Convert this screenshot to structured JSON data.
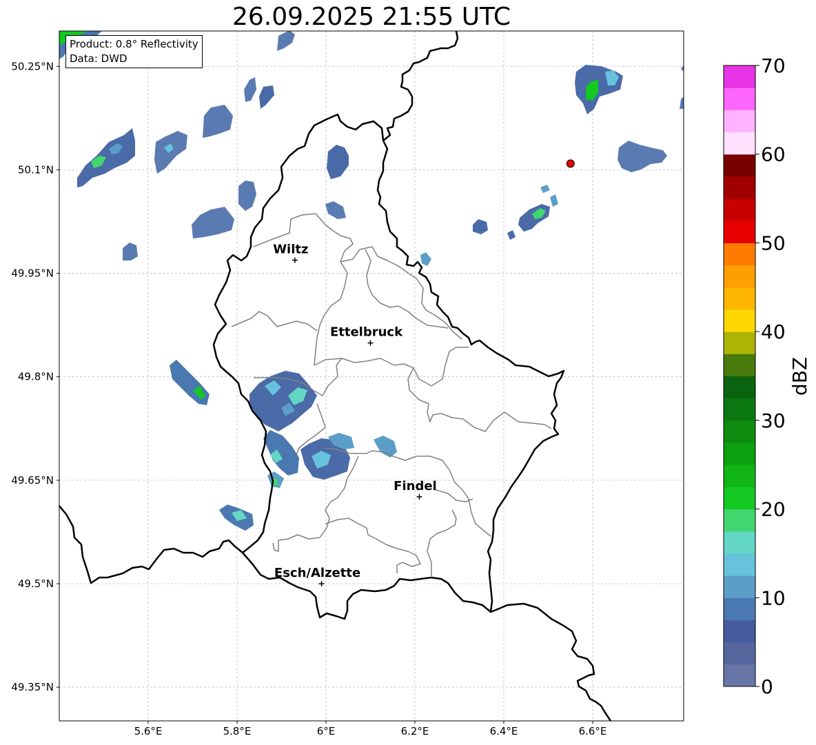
{
  "title": "26.09.2025 21:55 UTC",
  "info": {
    "product": "Product: 0.8° Reflectivity",
    "data": "Data: DWD"
  },
  "map": {
    "lat_ticks": [
      {
        "value": 50.25,
        "label": "50.25°N"
      },
      {
        "value": 50.1,
        "label": "50.1°N"
      },
      {
        "value": 49.95,
        "label": "49.95°N"
      },
      {
        "value": 49.8,
        "label": "49.8°N"
      },
      {
        "value": 49.65,
        "label": "49.65°N"
      },
      {
        "value": 49.5,
        "label": "49.5°N"
      },
      {
        "value": 49.35,
        "label": "49.35°N"
      }
    ],
    "lon_ticks": [
      {
        "value": 5.6,
        "label": "5.6°E"
      },
      {
        "value": 5.8,
        "label": "5.8°E"
      },
      {
        "value": 6.0,
        "label": "6°E"
      },
      {
        "value": 6.2,
        "label": "6.2°E"
      },
      {
        "value": 6.4,
        "label": "6.4°E"
      },
      {
        "value": 6.6,
        "label": "6.6°E"
      }
    ],
    "cities": [
      {
        "name": "Wiltz",
        "lon": 5.93,
        "lat": 49.969
      },
      {
        "name": "Ettelbruck",
        "lon": 6.1,
        "lat": 49.849
      },
      {
        "name": "Findel",
        "lon": 6.21,
        "lat": 49.626
      },
      {
        "name": "Esch/Alzette",
        "lon": 5.99,
        "lat": 49.5
      }
    ],
    "marker": {
      "lon": 6.55,
      "lat": 50.109,
      "color": "#e60000"
    },
    "border_color": "#000000",
    "district_color": "#808080"
  },
  "colorbar": {
    "label": "dBZ",
    "ticks": [
      "0",
      "10",
      "20",
      "30",
      "40",
      "50",
      "60",
      "70"
    ],
    "colors": [
      "#6776a7",
      "#56679e",
      "#445c9e",
      "#4a78b0",
      "#5b9ec8",
      "#67c2dd",
      "#63d6c4",
      "#41d66e",
      "#13c922",
      "#11b516",
      "#0ea10f",
      "#0d8c0f",
      "#0b7710",
      "#0a630e",
      "#487a0b",
      "#acb406",
      "#ffd700",
      "#ffb600",
      "#ff9e00",
      "#ff7b00",
      "#e60000",
      "#c80000",
      "#a00000",
      "#780000",
      "#ffe0ff",
      "#ffb3ff",
      "#ff66ff",
      "#e633e6"
    ]
  }
}
